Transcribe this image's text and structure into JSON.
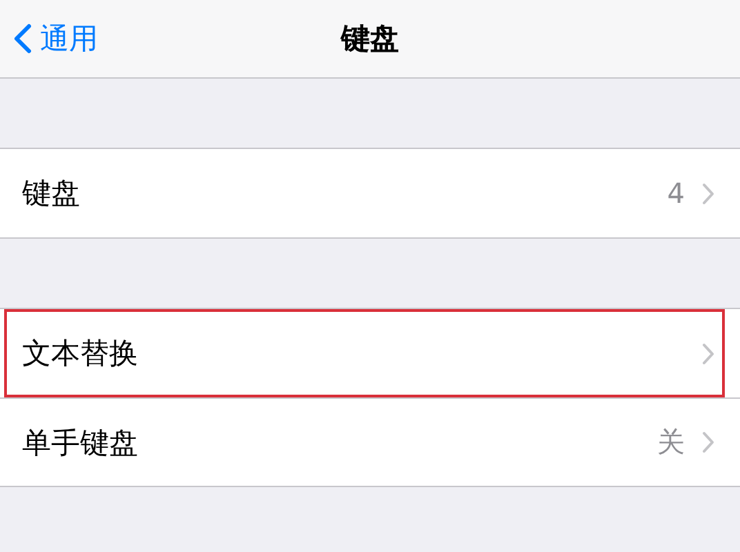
{
  "nav_bar": {
    "back_label": "通用",
    "title": "键盘"
  },
  "groups": [
    {
      "rows": [
        {
          "label": "键盘",
          "value": "4",
          "highlighted": false
        }
      ]
    },
    {
      "rows": [
        {
          "label": "文本替换",
          "highlighted": true
        },
        {
          "label": "单手键盘",
          "value": "关",
          "highlighted": false
        }
      ]
    }
  ]
}
